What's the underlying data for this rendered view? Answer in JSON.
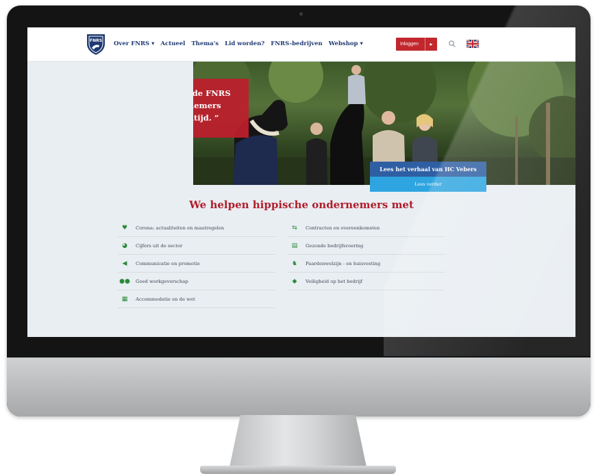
{
  "header": {
    "logo_text": "FNRS",
    "nav": [
      {
        "label": "Over FNRS ▾"
      },
      {
        "label": "Actueel"
      },
      {
        "label": "Thema's"
      },
      {
        "label": "Lid worden?"
      },
      {
        "label": "FNRS-bedrijven"
      },
      {
        "label": "Webshop ▾"
      }
    ],
    "login_label": "Inloggen",
    "search_icon": "search-icon",
    "language_icon": "uk-flag-icon"
  },
  "hero": {
    "quote": "“ We zijn blij met wat de FNRS voor hippische ondernemers doet, ook in de coronatijd. ”",
    "story_button": "Lees het verhaal van HC Vebers",
    "read_more_button": "Lees verder"
  },
  "help_section": {
    "title": "We helpen hippische ondernemers met",
    "left_items": [
      {
        "icon": "heart-icon",
        "label": "Corona: actualiteiten en maatregelen"
      },
      {
        "icon": "pie-chart-icon",
        "label": "Cijfers uit de sector"
      },
      {
        "icon": "megaphone-icon",
        "label": "Communicatie en promotie"
      },
      {
        "icon": "people-icon",
        "label": "Goed werkgeverschap"
      },
      {
        "icon": "building-icon",
        "label": "Accommodatie en de wet"
      }
    ],
    "right_items": [
      {
        "icon": "handshake-icon",
        "label": "Contracten en overeenkomsten"
      },
      {
        "icon": "document-icon",
        "label": "Gezonde bedrijfsvoering"
      },
      {
        "icon": "horse-icon",
        "label": "Paardenwelzijn - en huisvesting"
      },
      {
        "icon": "shield-icon",
        "label": "Veiligheid op het bedrijf"
      }
    ]
  },
  "colors": {
    "brand_blue": "#1f3a72",
    "brand_red": "#c1272d",
    "accent_green": "#2c8a3b",
    "button_blue": "#2f5fa3",
    "button_light_blue": "#2ea5e0"
  }
}
